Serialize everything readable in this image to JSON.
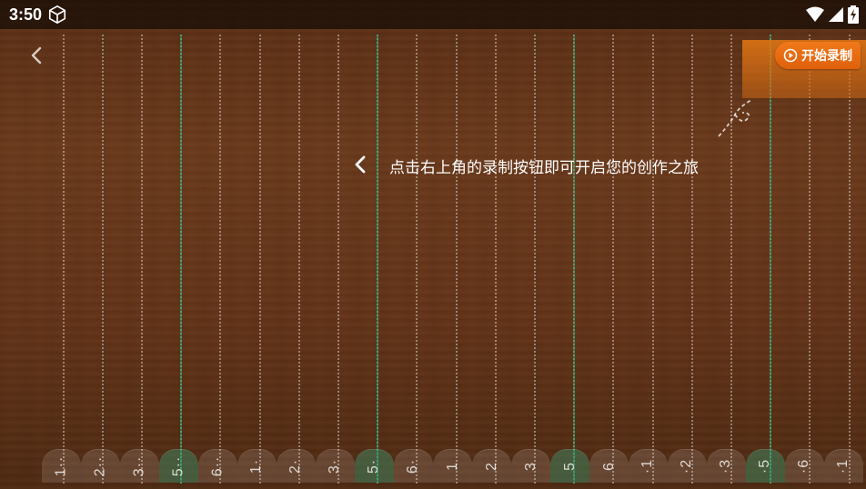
{
  "status_bar": {
    "time": "3:50",
    "icons": [
      "cube-icon",
      "wifi-icon",
      "signal-icon",
      "battery-charging-icon"
    ]
  },
  "nav": {
    "back_icon": "chevron-left-icon"
  },
  "record": {
    "label": "开始录制",
    "icon": "play-circle-icon",
    "accent": "#e8680f"
  },
  "hint": {
    "text": "点击右上角的录制按钮即可开启您的创作之旅",
    "icon": "chevron-left-icon"
  },
  "keys": [
    {
      "label": "1··",
      "green": false
    },
    {
      "label": "2··",
      "green": false
    },
    {
      "label": "3··",
      "green": false
    },
    {
      "label": "5··",
      "green": true
    },
    {
      "label": "6··",
      "green": false
    },
    {
      "label": "1·",
      "green": false
    },
    {
      "label": "2·",
      "green": false
    },
    {
      "label": "3·",
      "green": false
    },
    {
      "label": "5·",
      "green": true
    },
    {
      "label": "6·",
      "green": false
    },
    {
      "label": "1",
      "green": false
    },
    {
      "label": "2",
      "green": false
    },
    {
      "label": "3",
      "green": false
    },
    {
      "label": "5",
      "green": true
    },
    {
      "label": "6",
      "green": false
    },
    {
      "label": "·1",
      "green": false
    },
    {
      "label": "·2",
      "green": false
    },
    {
      "label": "·3",
      "green": false
    },
    {
      "label": "·5",
      "green": true
    },
    {
      "label": "·6",
      "green": false
    },
    {
      "label": "·1",
      "green": false
    }
  ],
  "colors": {
    "string_highlight": "#3cbe8c",
    "wood": "#6b3a1c"
  }
}
